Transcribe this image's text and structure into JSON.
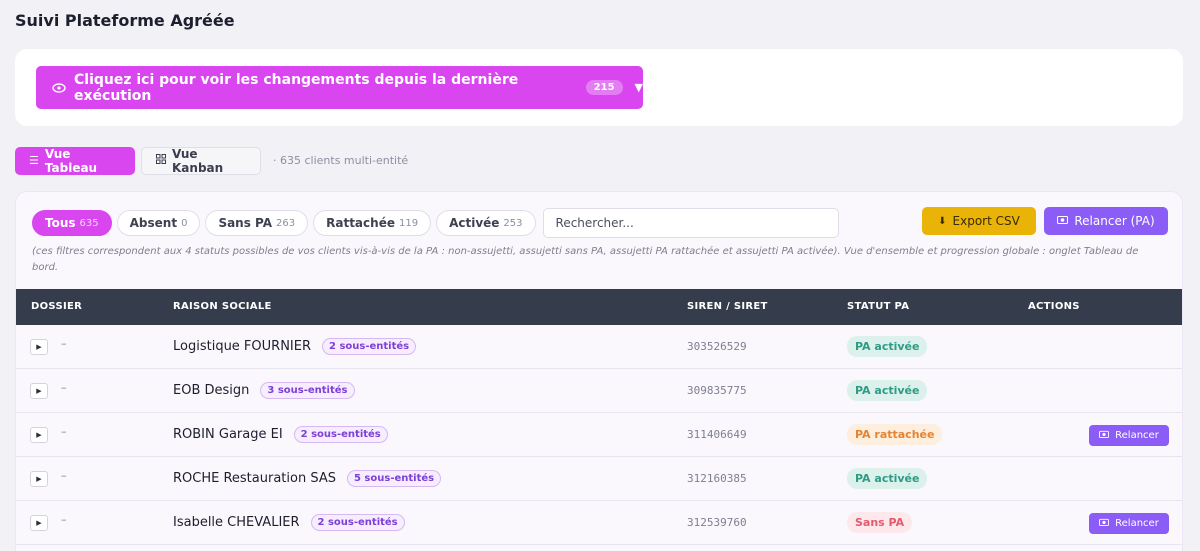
{
  "page": {
    "title": "Suivi Plateforme Agréée"
  },
  "changes": {
    "label": "Cliquez ici pour voir les changements depuis la dernière exécution",
    "count": "215",
    "caret": "▼"
  },
  "views": {
    "table_label": "Vue Tableau",
    "kanban_label": "Vue Kanban",
    "count_text": "· 635 clients multi-entité"
  },
  "filters": [
    {
      "label": "Tous",
      "count": "635",
      "active": true
    },
    {
      "label": "Absent",
      "count": "0",
      "active": false
    },
    {
      "label": "Sans PA",
      "count": "263",
      "active": false
    },
    {
      "label": "Rattachée",
      "count": "119",
      "active": false
    },
    {
      "label": "Activée",
      "count": "253",
      "active": false
    }
  ],
  "search": {
    "placeholder": "Rechercher..."
  },
  "actions": {
    "export_label": "Export CSV",
    "relance_label": "Relancer (PA)"
  },
  "note": "(ces filtres correspondent aux 4 statuts possibles de vos clients vis-à-vis de la PA : non-assujetti, assujetti sans PA, assujetti PA rattachée et assujetti PA activée). Vue d'ensemble et progression globale : onglet Tableau de bord.",
  "table": {
    "headers": {
      "dossier": "DOSSIER",
      "raison": "RAISON SOCIALE",
      "siren": "SIREN / SIRET",
      "statut": "STATUT PA",
      "actions": "ACTIONS"
    },
    "row_action_label": "Relancer",
    "rows": [
      {
        "dossier": "–",
        "name": "Logistique FOURNIER",
        "sub": "2 sous-entités",
        "siren": "303526529",
        "status": "PA activée",
        "status_kind": "activee",
        "has_action": false
      },
      {
        "dossier": "–",
        "name": "EOB Design",
        "sub": "3 sous-entités",
        "siren": "309835775",
        "status": "PA activée",
        "status_kind": "activee",
        "has_action": false
      },
      {
        "dossier": "–",
        "name": "ROBIN Garage EI",
        "sub": "2 sous-entités",
        "siren": "311406649",
        "status": "PA rattachée",
        "status_kind": "rattachee",
        "has_action": true
      },
      {
        "dossier": "–",
        "name": "ROCHE Restauration SAS",
        "sub": "5 sous-entités",
        "siren": "312160385",
        "status": "PA activée",
        "status_kind": "activee",
        "has_action": false
      },
      {
        "dossier": "–",
        "name": "Isabelle CHEVALIER",
        "sub": "2 sous-entités",
        "siren": "312539760",
        "status": "Sans PA",
        "status_kind": "sanspa",
        "has_action": true
      }
    ]
  },
  "colors": {
    "accent": "#d946ef",
    "violet": "#8b5cf6",
    "yellow": "#eab308",
    "header": "#353c4c"
  }
}
